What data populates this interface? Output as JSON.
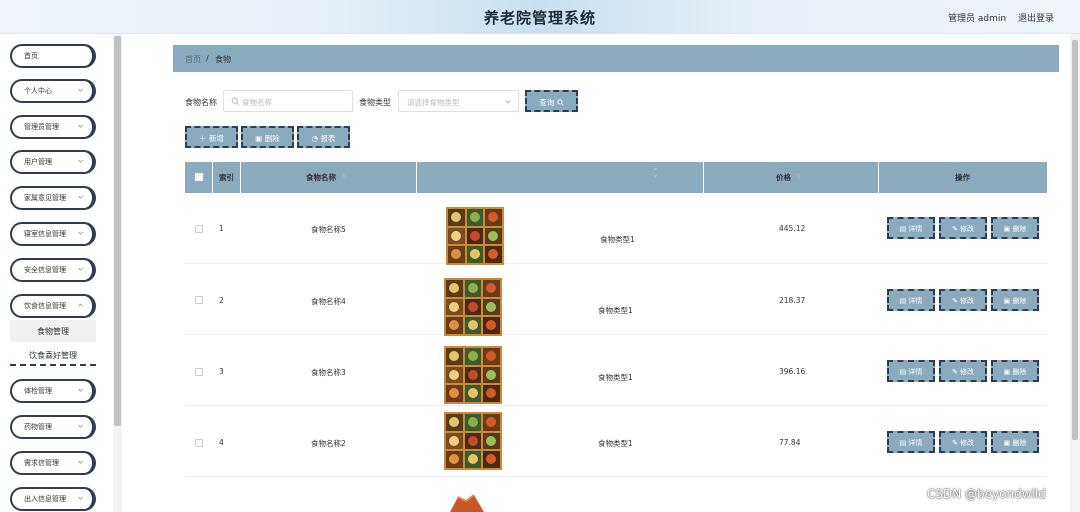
{
  "header": {
    "title": "养老院管理系统",
    "user": "管理员 admin",
    "logout": "退出登录"
  },
  "sidebar": {
    "items": [
      {
        "label": "首页",
        "has_chevron": false
      },
      {
        "label": "个人中心",
        "has_chevron": true
      },
      {
        "label": "管理员管理",
        "has_chevron": true
      },
      {
        "label": "用户管理",
        "has_chevron": true
      },
      {
        "label": "家属意见管理",
        "has_chevron": true
      },
      {
        "label": "寝室信息管理",
        "has_chevron": true
      },
      {
        "label": "安全信息管理",
        "has_chevron": true
      },
      {
        "label": "饮食信息管理",
        "has_chevron": true
      },
      {
        "label": "体检管理",
        "has_chevron": true
      },
      {
        "label": "药物管理",
        "has_chevron": true
      },
      {
        "label": "需求信管理",
        "has_chevron": true
      },
      {
        "label": "出入信息管理",
        "has_chevron": true
      }
    ],
    "submenu": [
      "食物管理",
      "饮食喜好管理"
    ]
  },
  "breadcrumb": {
    "home": "首页",
    "separator": "/",
    "current": "食物"
  },
  "search": {
    "name_label": "食物名称",
    "name_placeholder": "食物名称",
    "type_label": "食物类型",
    "type_placeholder": "请选择食物类型",
    "query_button": "查询"
  },
  "toolbar": {
    "add": "新增",
    "delete": "删除",
    "report": "报表"
  },
  "table": {
    "headers": {
      "index": "索引",
      "name": "食物名称",
      "price": "价格",
      "actions": "操作"
    },
    "rows": [
      {
        "index": "1",
        "name": "食物名称5",
        "type": "食物类型1",
        "price": "445.12"
      },
      {
        "index": "2",
        "name": "食物名称4",
        "type": "食物类型1",
        "price": "218.37"
      },
      {
        "index": "3",
        "name": "食物名称3",
        "type": "食物类型1",
        "price": "396.16"
      },
      {
        "index": "4",
        "name": "食物名称2",
        "type": "食物类型1",
        "price": "77.84"
      }
    ],
    "row_actions": {
      "detail": "详情",
      "edit": "修改",
      "delete": "删除"
    }
  },
  "watermark": "CSDN @beyondwild",
  "colors": {
    "accent": "#8aabbe",
    "border_dark": "#2c3e50"
  }
}
